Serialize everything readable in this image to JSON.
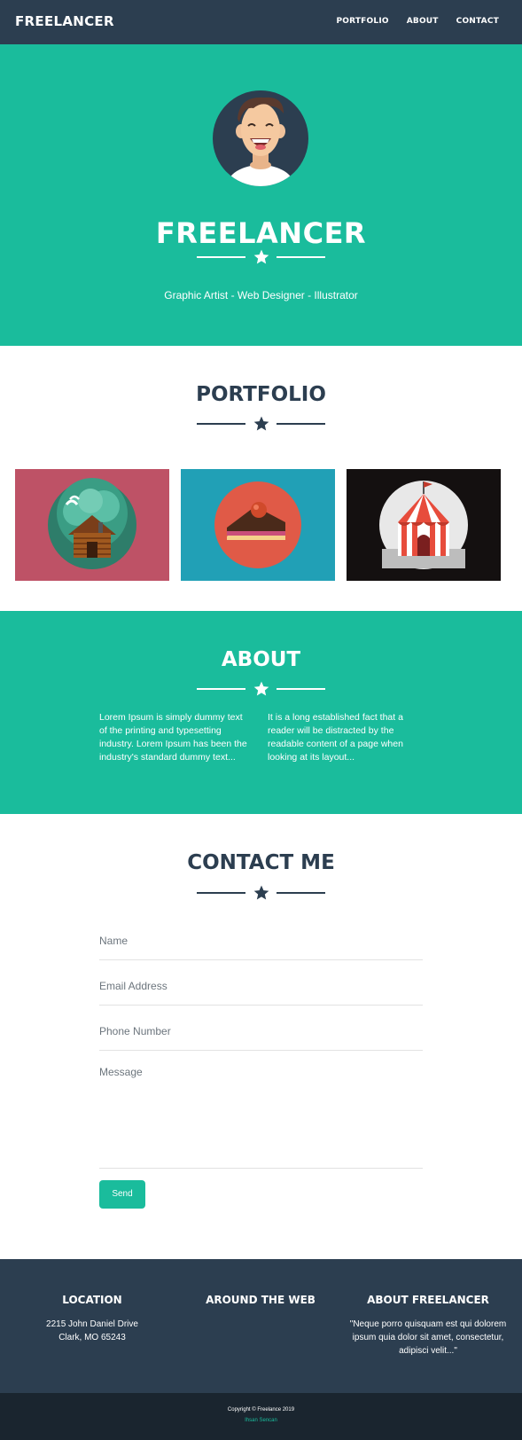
{
  "colors": {
    "primary": "#1abc9c",
    "dark": "#2c3e50",
    "darker": "#1a252f",
    "tile_cabin": "#be5266",
    "tile_cake": "#21a0b6",
    "tile_circus": "#141010"
  },
  "navbar": {
    "brand": "FREELANCER",
    "links": [
      "PORTFOLIO",
      "ABOUT",
      "CONTACT"
    ]
  },
  "hero": {
    "title": "FREELANCER",
    "subtitle": "Graphic Artist - Web Designer - Illustrator",
    "avatar_icon": "avatar-icon",
    "divider_icon": "star-icon"
  },
  "portfolio": {
    "title": "PORTFOLIO",
    "items": [
      {
        "icon": "cabin-icon"
      },
      {
        "icon": "cake-icon"
      },
      {
        "icon": "circus-tent-icon"
      }
    ]
  },
  "about": {
    "title": "ABOUT",
    "col1": "Lorem Ipsum is simply dummy text of the printing and typesetting industry. Lorem Ipsum has been the industry's standard dummy text...",
    "col2": "It is a long established fact that a reader will be distracted by the readable content of a page when looking at its layout..."
  },
  "contact": {
    "title": "CONTACT ME",
    "name_placeholder": "Name",
    "email_placeholder": "Email Address",
    "phone_placeholder": "Phone Number",
    "message_placeholder": "Message",
    "send_label": "Send"
  },
  "footer": {
    "location_title": "LOCATION",
    "address_line1": "2215 John Daniel Drive",
    "address_line2": "Clark, MO 65243",
    "web_title": "AROUND THE WEB",
    "about_title": "ABOUT FREELANCER",
    "about_text": "\"Neque porro quisquam est qui dolorem ipsum quia dolor sit amet, consectetur, adipisci velit...\"",
    "copyright": "Copyright © Freelance 2019",
    "author": "Ihsan Sencan"
  }
}
